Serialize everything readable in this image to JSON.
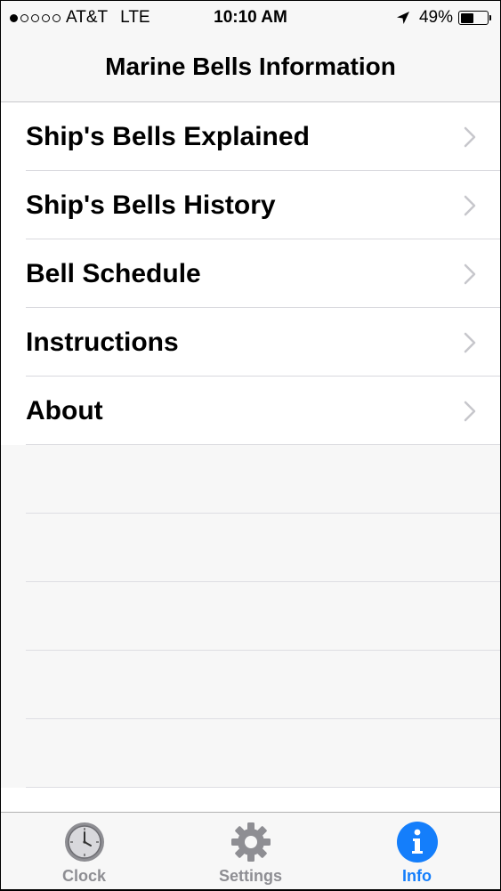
{
  "status_bar": {
    "carrier": "AT&T",
    "network": "LTE",
    "time": "10:10 AM",
    "battery_percent": "49%",
    "battery_level": 0.49,
    "signal_bars_filled": 1,
    "signal_bars_total": 5
  },
  "nav": {
    "title": "Marine Bells Information"
  },
  "menu": {
    "items": [
      {
        "label": "Ship's Bells Explained"
      },
      {
        "label": "Ship's Bells History"
      },
      {
        "label": "Bell Schedule"
      },
      {
        "label": "Instructions"
      },
      {
        "label": "About"
      }
    ]
  },
  "tab_bar": {
    "tabs": [
      {
        "label": "Clock",
        "icon": "clock-icon",
        "active": false
      },
      {
        "label": "Settings",
        "icon": "gear-icon",
        "active": false
      },
      {
        "label": "Info",
        "icon": "info-icon",
        "active": true
      }
    ]
  },
  "colors": {
    "accent": "#147efb",
    "inactive": "#8e8e93"
  }
}
